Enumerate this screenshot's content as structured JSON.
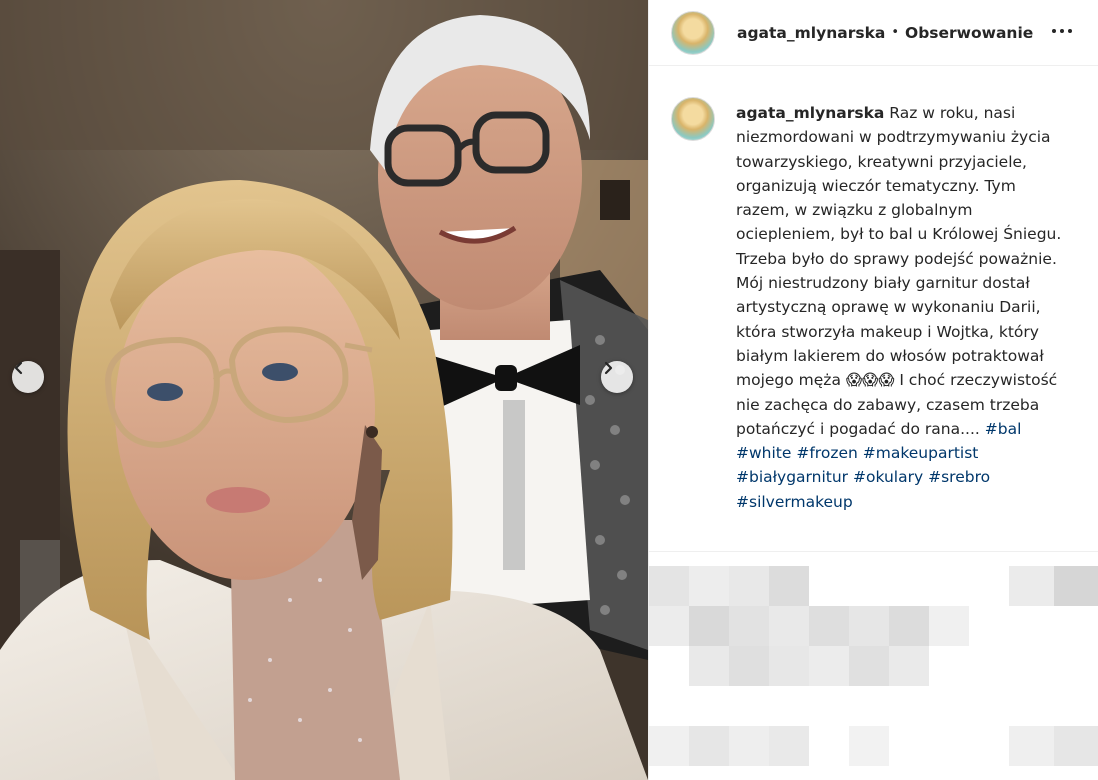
{
  "post": {
    "username": "agata_mlynarska",
    "separator": "•",
    "follow_status": "Obserwowanie",
    "caption_text": "Raz w roku, nasi niezmordowani w podtrzymywaniu życia towarzyskiego, kreatywni przyjaciele, organizują wieczór tematyczny. Tym razem, w związku z globalnym ociepleniem, był to bal u Królowej Śniegu. Trzeba było do sprawy podejść poważnie. Mój niestrudzony biały garnitur dostał artystyczną oprawę w wykonaniu Darii, która stworzyła makeup i Wojtka, który białym lakierem do włosów potraktował mojego męża",
    "emojis": "😱😱😱",
    "caption_tail": "I choć rzeczywistość nie zachęca do zabawy, czasem trzeba potańczyć i pogadać do rana....",
    "hashtags": [
      "#bal",
      "#white",
      "#frozen",
      "#makeupartist",
      "#białygarnitur",
      "#okulary",
      "#srebro",
      "#silvermakeup"
    ]
  },
  "icons": {
    "more": "more-horizontal-icon",
    "prev": "chevron-left-icon",
    "next": "chevron-right-icon"
  },
  "colors": {
    "hashtag": "#00376b",
    "text": "#262626",
    "divider": "#efefef"
  }
}
